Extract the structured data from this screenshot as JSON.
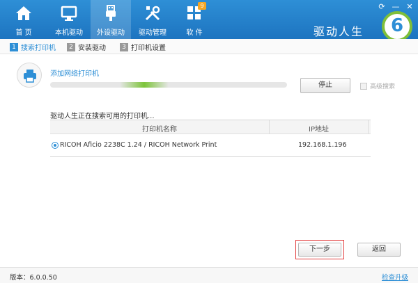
{
  "nav": {
    "items": [
      {
        "label": "首 页",
        "icon": "home-icon"
      },
      {
        "label": "本机驱动",
        "icon": "monitor-icon"
      },
      {
        "label": "外设驱动",
        "icon": "usb-icon"
      },
      {
        "label": "驱动管理",
        "icon": "tools-icon"
      },
      {
        "label": "软 件",
        "icon": "apps-icon",
        "badge": "9"
      }
    ],
    "active_index": 2
  },
  "window": {
    "controls": [
      "restore-icon",
      "minimize-icon",
      "close-icon"
    ]
  },
  "brand": {
    "name": "驱动人生",
    "logo_digit": "6"
  },
  "steps": [
    {
      "num": "1",
      "label": "搜索打印机"
    },
    {
      "num": "2",
      "label": "安装驱动"
    },
    {
      "num": "3",
      "label": "打印机设置"
    }
  ],
  "search": {
    "add_network_printer": "添加网络打印机",
    "stop_label": "停止",
    "advanced_search": "高级搜索",
    "status_text": "驱动人生正在搜索可用的打印机..."
  },
  "table": {
    "headers": [
      "打印机名称",
      "IP地址"
    ],
    "rows": [
      {
        "name": "RICOH Aficio 2238C 1.24 / RICOH Network Print",
        "ip": "192.168.1.196",
        "selected": true
      }
    ]
  },
  "actions": {
    "next_label": "下一步",
    "back_label": "返回"
  },
  "footer": {
    "version": "版本：6.0.0.50",
    "check_update": "检查升级"
  },
  "colors": {
    "header": "#1d74c0",
    "accent": "#2e8fd6",
    "progress": "#7cc43a",
    "highlight": "#e23c3c"
  }
}
